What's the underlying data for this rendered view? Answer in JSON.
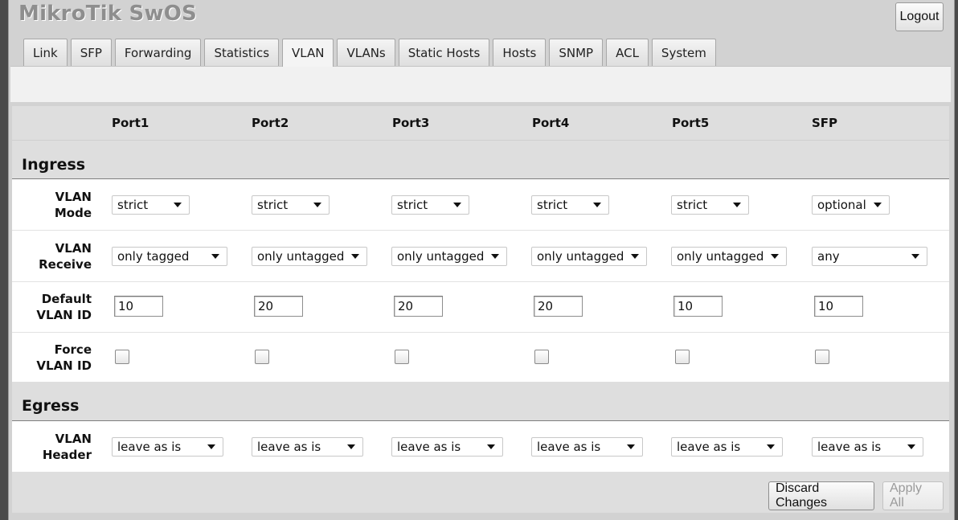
{
  "app": {
    "title": "MikroTik SwOS",
    "logout_label": "Logout"
  },
  "tabs": [
    {
      "label": "Link",
      "active": false
    },
    {
      "label": "SFP",
      "active": false
    },
    {
      "label": "Forwarding",
      "active": false
    },
    {
      "label": "Statistics",
      "active": false
    },
    {
      "label": "VLAN",
      "active": true
    },
    {
      "label": "VLANs",
      "active": false
    },
    {
      "label": "Static Hosts",
      "active": false
    },
    {
      "label": "Hosts",
      "active": false
    },
    {
      "label": "SNMP",
      "active": false
    },
    {
      "label": "ACL",
      "active": false
    },
    {
      "label": "System",
      "active": false
    }
  ],
  "columns": [
    "Port1",
    "Port2",
    "Port3",
    "Port4",
    "Port5",
    "SFP"
  ],
  "ingress": {
    "title": "Ingress",
    "vlan_mode": {
      "label_line1": "VLAN",
      "label_line2": "Mode",
      "values": [
        "strict",
        "strict",
        "strict",
        "strict",
        "strict",
        "optional"
      ]
    },
    "vlan_receive": {
      "label_line1": "VLAN",
      "label_line2": "Receive",
      "values": [
        "only tagged",
        "only untagged",
        "only untagged",
        "only untagged",
        "only untagged",
        "any"
      ]
    },
    "default_vlan_id": {
      "label_line1": "Default",
      "label_line2": "VLAN ID",
      "values": [
        "10",
        "20",
        "20",
        "20",
        "10",
        "10"
      ]
    },
    "force_vlan_id": {
      "label_line1": "Force",
      "label_line2": "VLAN ID",
      "values": [
        false,
        false,
        false,
        false,
        false,
        false
      ]
    }
  },
  "egress": {
    "title": "Egress",
    "vlan_header": {
      "label_line1": "VLAN",
      "label_line2": "Header",
      "values": [
        "leave as is",
        "leave as is",
        "leave as is",
        "leave as is",
        "leave as is",
        "leave as is"
      ]
    }
  },
  "buttons": {
    "discard": "Discard Changes",
    "apply": "Apply All",
    "apply_disabled": true
  }
}
